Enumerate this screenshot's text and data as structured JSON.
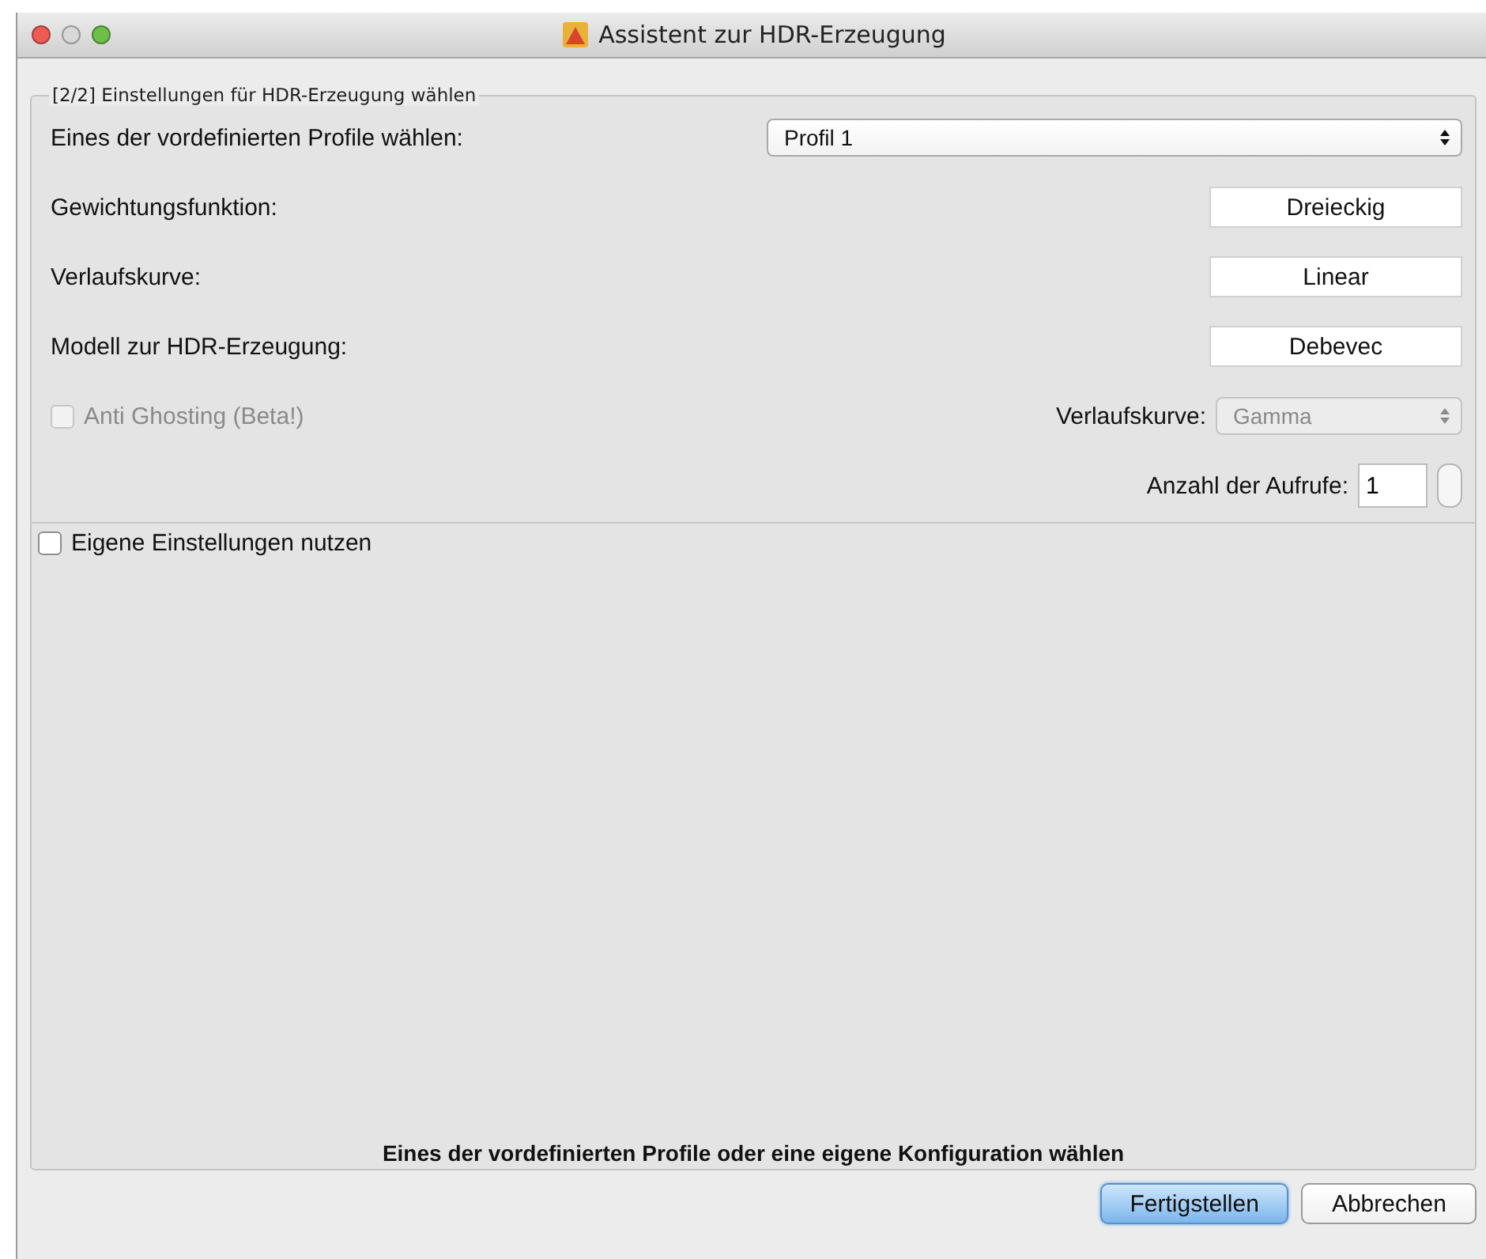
{
  "window": {
    "title": "Assistent zur HDR-Erzeugung"
  },
  "group": {
    "title": "[2/2] Einstellungen für HDR-Erzeugung wählen"
  },
  "profile": {
    "label": "Eines der vordefinierten Profile wählen:",
    "value": "Profil 1"
  },
  "settings": [
    {
      "label": "Gewichtungsfunktion:",
      "value": "Dreieckig"
    },
    {
      "label": "Verlaufskurve:",
      "value": "Linear"
    },
    {
      "label": "Modell zur HDR-Erzeugung:",
      "value": "Debevec"
    }
  ],
  "anti_ghosting": {
    "label": "Anti Ghosting (Beta!)",
    "checked": false,
    "disabled": true
  },
  "ghost_curve": {
    "label": "Verlaufskurve:",
    "value": "Gamma",
    "disabled": true
  },
  "iterations": {
    "label": "Anzahl der Aufrufe:",
    "value": "1"
  },
  "custom": {
    "label": "Eigene Einstellungen nutzen",
    "checked": false
  },
  "status": "Eines der vordefinierten Profile oder eine eigene Konfiguration wählen",
  "buttons": [
    {
      "label": "Fertigstellen",
      "default": true
    },
    {
      "label": "Abbrechen",
      "default": false
    }
  ]
}
